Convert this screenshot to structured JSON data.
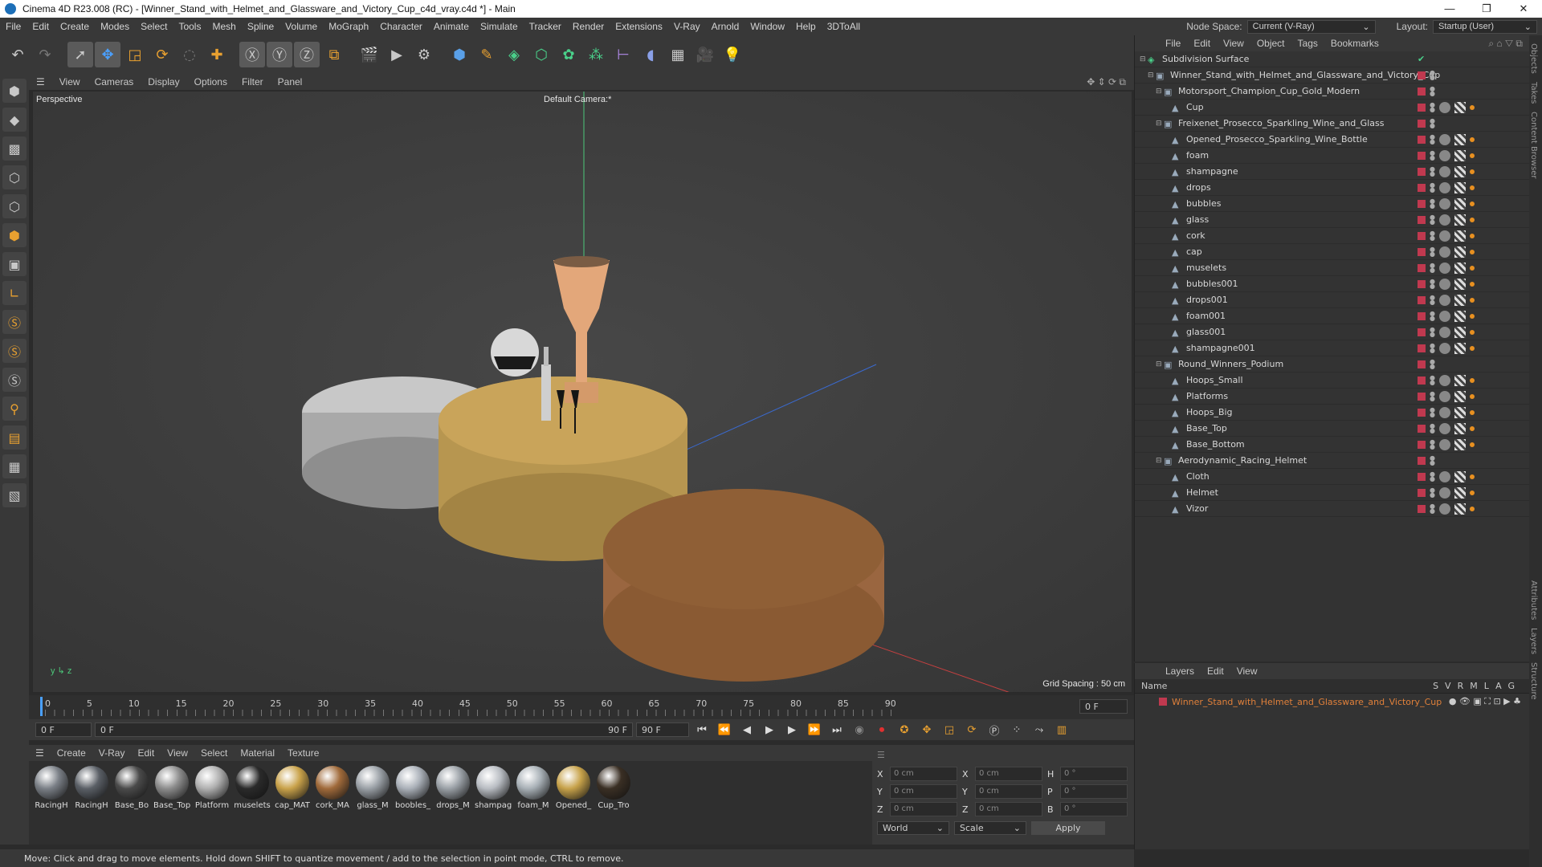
{
  "title": "Cinema 4D R23.008 (RC) - [Winner_Stand_with_Helmet_and_Glassware_and_Victory_Cup_c4d_vray.c4d *] - Main",
  "menus": [
    "File",
    "Edit",
    "Create",
    "Modes",
    "Select",
    "Tools",
    "Mesh",
    "Spline",
    "Volume",
    "MoGraph",
    "Character",
    "Animate",
    "Simulate",
    "Tracker",
    "Render",
    "Extensions",
    "V-Ray",
    "Arnold",
    "Window",
    "Help",
    "3DToAll"
  ],
  "node_space_label": "Node Space:",
  "node_space_value": "Current (V-Ray)",
  "layout_label": "Layout:",
  "layout_value": "Startup (User)",
  "viewport_menu": [
    "View",
    "Cameras",
    "Display",
    "Options",
    "Filter",
    "Panel"
  ],
  "viewport": {
    "perspective_label": "Perspective",
    "camera_label": "Default Camera:*",
    "grid_spacing": "Grid Spacing : 50 cm"
  },
  "timeline": {
    "ticks": [
      "0",
      "5",
      "10",
      "15",
      "20",
      "25",
      "30",
      "35",
      "40",
      "45",
      "50",
      "55",
      "60",
      "65",
      "70",
      "75",
      "80",
      "85",
      "90"
    ],
    "end_field": "0 F"
  },
  "playbar": {
    "start": "0 F",
    "range_start": "0 F",
    "range_end": "90 F",
    "end": "90 F"
  },
  "material_menu": [
    "Create",
    "V-Ray",
    "Edit",
    "View",
    "Select",
    "Material",
    "Texture"
  ],
  "materials": [
    {
      "label": "RacingH",
      "color": "#7a7f86"
    },
    {
      "label": "RacingH",
      "color": "#5a5f66"
    },
    {
      "label": "Base_Bo",
      "color": "#4a4a4a"
    },
    {
      "label": "Base_Top",
      "color": "#8c8c8c"
    },
    {
      "label": "Platform",
      "color": "#b0b0b0"
    },
    {
      "label": "muselets",
      "color": "#2a2a2a"
    },
    {
      "label": "cap_MAT",
      "color": "#c9a24a"
    },
    {
      "label": "cork_MA",
      "color": "#a06a3a"
    },
    {
      "label": "glass_M",
      "color": "#9aa0a6"
    },
    {
      "label": "boobles_",
      "color": "#aab0b8"
    },
    {
      "label": "drops_M",
      "color": "#9aa0a6"
    },
    {
      "label": "shampag",
      "color": "#b8bcc2"
    },
    {
      "label": "foam_M",
      "color": "#a8b0b6"
    },
    {
      "label": "Opened_",
      "color": "#c7a24a"
    },
    {
      "label": "Cup_Tro",
      "color": "#3a2f24"
    }
  ],
  "coords": {
    "rows": [
      {
        "a": "X",
        "av": "0 cm",
        "b": "X",
        "bv": "0 cm",
        "c": "H",
        "cv": "0 °"
      },
      {
        "a": "Y",
        "av": "0 cm",
        "b": "Y",
        "bv": "0 cm",
        "c": "P",
        "cv": "0 °"
      },
      {
        "a": "Z",
        "av": "0 cm",
        "b": "Z",
        "bv": "0 cm",
        "c": "B",
        "cv": "0 °"
      }
    ],
    "world": "World",
    "scale": "Scale",
    "apply": "Apply"
  },
  "status": "Move: Click and drag to move elements. Hold down SHIFT to quantize movement / add to the selection in point mode, CTRL to remove.",
  "object_menu": [
    "File",
    "Edit",
    "View",
    "Object",
    "Tags",
    "Bookmarks"
  ],
  "objects": [
    {
      "name": "Subdivision Surface",
      "level": 0,
      "tags": false
    },
    {
      "name": "Winner_Stand_with_Helmet_and_Glassware_and_Victory_Cup",
      "level": 1,
      "tags": false
    },
    {
      "name": "Motorsport_Champion_Cup_Gold_Modern",
      "level": 2,
      "tags": false
    },
    {
      "name": "Cup",
      "level": 3,
      "tags": true
    },
    {
      "name": "Freixenet_Prosecco_Sparkling_Wine_and_Glass",
      "level": 2,
      "tags": false
    },
    {
      "name": "Opened_Prosecco_Sparkling_Wine_Bottle",
      "level": 3,
      "tags": true
    },
    {
      "name": "foam",
      "level": 3,
      "tags": true
    },
    {
      "name": "shampagne",
      "level": 3,
      "tags": true
    },
    {
      "name": "drops",
      "level": 3,
      "tags": true
    },
    {
      "name": "bubbles",
      "level": 3,
      "tags": true
    },
    {
      "name": "glass",
      "level": 3,
      "tags": true
    },
    {
      "name": "cork",
      "level": 3,
      "tags": true
    },
    {
      "name": "cap",
      "level": 3,
      "tags": true
    },
    {
      "name": "muselets",
      "level": 3,
      "tags": true
    },
    {
      "name": "bubbles001",
      "level": 3,
      "tags": true
    },
    {
      "name": "drops001",
      "level": 3,
      "tags": true
    },
    {
      "name": "foam001",
      "level": 3,
      "tags": true
    },
    {
      "name": "glass001",
      "level": 3,
      "tags": true
    },
    {
      "name": "shampagne001",
      "level": 3,
      "tags": true
    },
    {
      "name": "Round_Winners_Podium",
      "level": 2,
      "tags": false
    },
    {
      "name": "Hoops_Small",
      "level": 3,
      "tags": true
    },
    {
      "name": "Platforms",
      "level": 3,
      "tags": true
    },
    {
      "name": "Hoops_Big",
      "level": 3,
      "tags": true
    },
    {
      "name": "Base_Top",
      "level": 3,
      "tags": true
    },
    {
      "name": "Base_Bottom",
      "level": 3,
      "tags": true
    },
    {
      "name": "Aerodynamic_Racing_Helmet",
      "level": 2,
      "tags": false
    },
    {
      "name": "Cloth",
      "level": 3,
      "tags": true
    },
    {
      "name": "Helmet",
      "level": 3,
      "tags": true
    },
    {
      "name": "Vizor",
      "level": 3,
      "tags": true
    }
  ],
  "layer_menu": [
    "Layers",
    "Edit",
    "View"
  ],
  "layer_header": {
    "name": "Name",
    "cols": [
      "S",
      "V",
      "R",
      "M",
      "L",
      "A",
      "G"
    ]
  },
  "layer_row": "Winner_Stand_with_Helmet_and_Glassware_and_Victory_Cup",
  "side_tabs": [
    "Objects",
    "Takes",
    "Content Browser",
    "Attributes",
    "Layers",
    "Structure"
  ]
}
